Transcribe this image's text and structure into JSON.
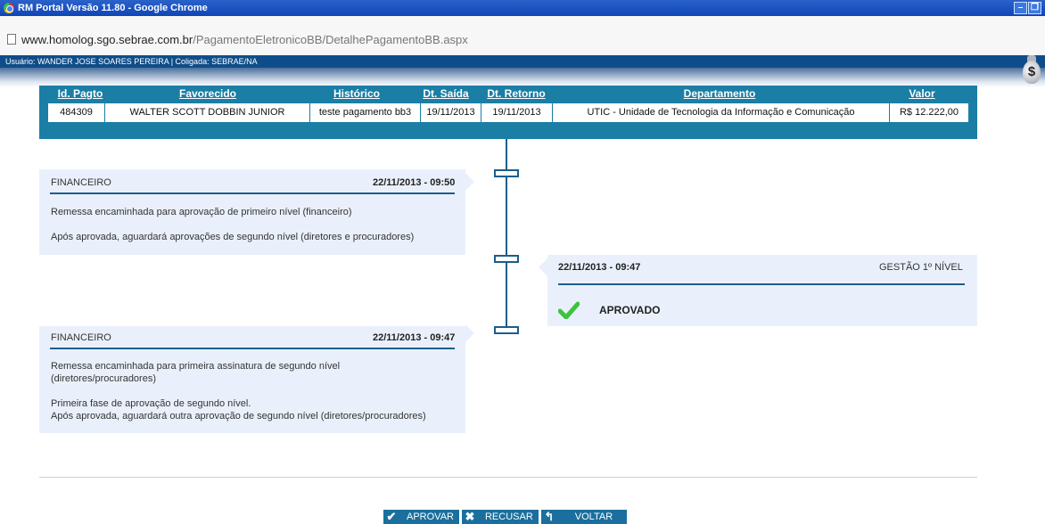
{
  "window": {
    "title": "RM Portal Versão 11.80 - Google Chrome"
  },
  "browser": {
    "url_host": "www.homolog.sgo.sebrae.com.br",
    "url_path": "/PagamentoEletronicoBB/DetalhePagamentoBB.aspx"
  },
  "userbar": {
    "text": "Usuário: WANDER JOSE SOARES PEREIRA | Coligada: SEBRAE/NA"
  },
  "money_icon": {
    "symbol": "$"
  },
  "grid": {
    "headers": [
      "Id. Pagto",
      "Favorecido",
      "Histórico",
      "Dt. Saída",
      "Dt. Retorno",
      "Departamento",
      "Valor"
    ],
    "row": [
      "484309",
      "WALTER SCOTT DOBBIN JUNIOR",
      "teste pagamento bb3",
      "19/11/2013",
      "19/11/2013",
      "UTIC - Unidade de Tecnologia da Informação e Comunicação",
      "R$ 12.222,00"
    ]
  },
  "timeline": [
    {
      "side": "left",
      "title": "FINANCEIRO",
      "datetime": "22/11/2013 - 09:50",
      "lines": [
        "Remessa encaminhada para aprovação de primeiro nível (financeiro)",
        "Após aprovada, aguardará aprovações de segundo nível (diretores e procuradores)"
      ]
    },
    {
      "side": "right",
      "title": "GESTÃO 1º NÍVEL",
      "datetime": "22/11/2013 - 09:47",
      "status": "APROVADO"
    },
    {
      "side": "left",
      "title": "FINANCEIRO",
      "datetime": "22/11/2013 - 09:47",
      "lines": [
        "Remessa encaminhada para primeira assinatura de segundo nível",
        "(diretores/procuradores)",
        "Primeira fase de aprovação de segundo nível.",
        "Após aprovada, aguardará outra aprovação de segundo nível (diretores/procuradores)"
      ]
    }
  ],
  "actions": {
    "approve": "APROVAR",
    "reject": "RECUSAR",
    "back": "VOLTAR"
  },
  "colors": {
    "accent": "#1a7ea5",
    "card_bg": "#eaf0fb",
    "approve_check": "#3dc43d"
  }
}
